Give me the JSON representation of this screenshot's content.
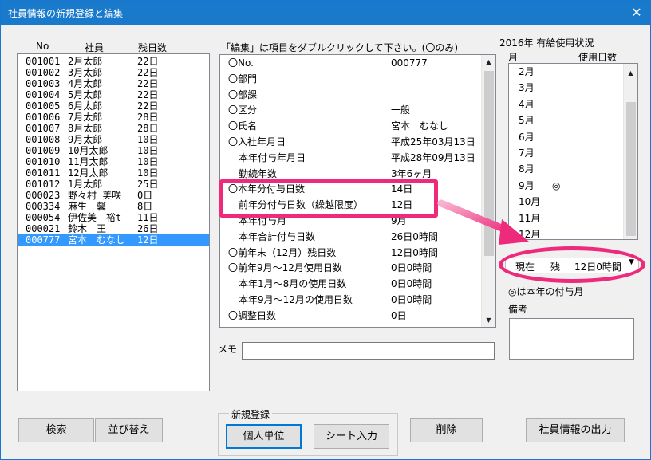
{
  "window": {
    "title": "社員情報の新規登録と編集",
    "close_glyph": "✕"
  },
  "employee_list": {
    "headers": {
      "no": "No",
      "name": "社員",
      "days": "残日数"
    },
    "rows": [
      {
        "no": "001001",
        "name": "2月太郎",
        "days": "22日"
      },
      {
        "no": "001002",
        "name": "3月太郎",
        "days": "22日"
      },
      {
        "no": "001003",
        "name": "4月太郎",
        "days": "22日"
      },
      {
        "no": "001004",
        "name": "5月太郎",
        "days": "22日"
      },
      {
        "no": "001005",
        "name": "6月太郎",
        "days": "22日"
      },
      {
        "no": "001006",
        "name": "7月太郎",
        "days": "28日"
      },
      {
        "no": "001007",
        "name": "8月太郎",
        "days": "28日"
      },
      {
        "no": "001008",
        "name": "9月太郎",
        "days": "10日"
      },
      {
        "no": "001009",
        "name": "10月太郎",
        "days": "10日"
      },
      {
        "no": "001010",
        "name": "11月太郎",
        "days": "10日"
      },
      {
        "no": "001011",
        "name": "12月太郎",
        "days": "10日"
      },
      {
        "no": "001012",
        "name": "1月太郎",
        "days": "25日"
      },
      {
        "no": "000023",
        "name": "野々村 美咲",
        "days": "0日"
      },
      {
        "no": "000334",
        "name": "麻生　馨",
        "days": "8日"
      },
      {
        "no": "000054",
        "name": "伊佐美　裕t",
        "days": "11日"
      },
      {
        "no": "000021",
        "name": "鈴木　王",
        "days": "26日"
      },
      {
        "no": "000777",
        "name": "宮本　むなし",
        "days": "12日"
      }
    ]
  },
  "edit_panel": {
    "instruction": "「編集」は項目をダブルクリックして下さい。(〇のみ)",
    "fields": [
      {
        "label": "〇No.",
        "value": "000777"
      },
      {
        "label": "〇部門",
        "value": ""
      },
      {
        "label": "〇部課",
        "value": ""
      },
      {
        "label": "〇区分",
        "value": "一般"
      },
      {
        "label": "〇氏名",
        "value": "宮本　むなし"
      },
      {
        "label": "〇入社年月日",
        "value": "平成25年03月13日"
      },
      {
        "label": "本年付与年月日",
        "value": "平成28年09月13日"
      },
      {
        "label": "勤続年数",
        "value": "3年6ヶ月"
      },
      {
        "label": "〇本年分付与日数",
        "value": "14日"
      },
      {
        "label": "前年分付与日数（繰越限度）",
        "value": "12日"
      },
      {
        "label": "本年付与月",
        "value": "9月"
      },
      {
        "label": "本年合計付与日数",
        "value": "26日0時間"
      },
      {
        "label": "〇前年末（12月）残日数",
        "value": "12日0時間"
      },
      {
        "label": "〇前年9月～12月使用日数",
        "value": "0日0時間"
      },
      {
        "label": "本年1月～8月の使用日数",
        "value": "0日0時間"
      },
      {
        "label": "本年9月～12月の使用日数",
        "value": "0日0時間"
      },
      {
        "label": "〇調整日数",
        "value": "0日"
      }
    ],
    "memo_label": "メモ",
    "memo_value": ""
  },
  "usage_panel": {
    "title": "2016年 有給使用状況",
    "col_month": "月",
    "col_days": "使用日数",
    "months": [
      {
        "month": "2月",
        "mark": ""
      },
      {
        "month": "3月",
        "mark": ""
      },
      {
        "month": "4月",
        "mark": ""
      },
      {
        "month": "5月",
        "mark": ""
      },
      {
        "month": "6月",
        "mark": ""
      },
      {
        "month": "7月",
        "mark": ""
      },
      {
        "month": "8月",
        "mark": ""
      },
      {
        "month": "9月",
        "mark": "◎"
      },
      {
        "month": "10月",
        "mark": ""
      },
      {
        "month": "11月",
        "mark": ""
      },
      {
        "month": "12月",
        "mark": ""
      }
    ],
    "current": {
      "label1": "現在",
      "label2": "残",
      "value": "12日0時間"
    },
    "legend": "◎は本年の付与月",
    "notes_label": "備考",
    "notes_value": ""
  },
  "buttons": {
    "search": "検索",
    "sort": "並び替え",
    "group_title": "新規登録",
    "individual": "個人単位",
    "sheet_input": "シート入力",
    "delete": "削除",
    "export": "社員情報の出力"
  },
  "colors": {
    "title_bar": "#1979ca",
    "selection": "#3399ff",
    "highlight": "#ee2a7b"
  }
}
